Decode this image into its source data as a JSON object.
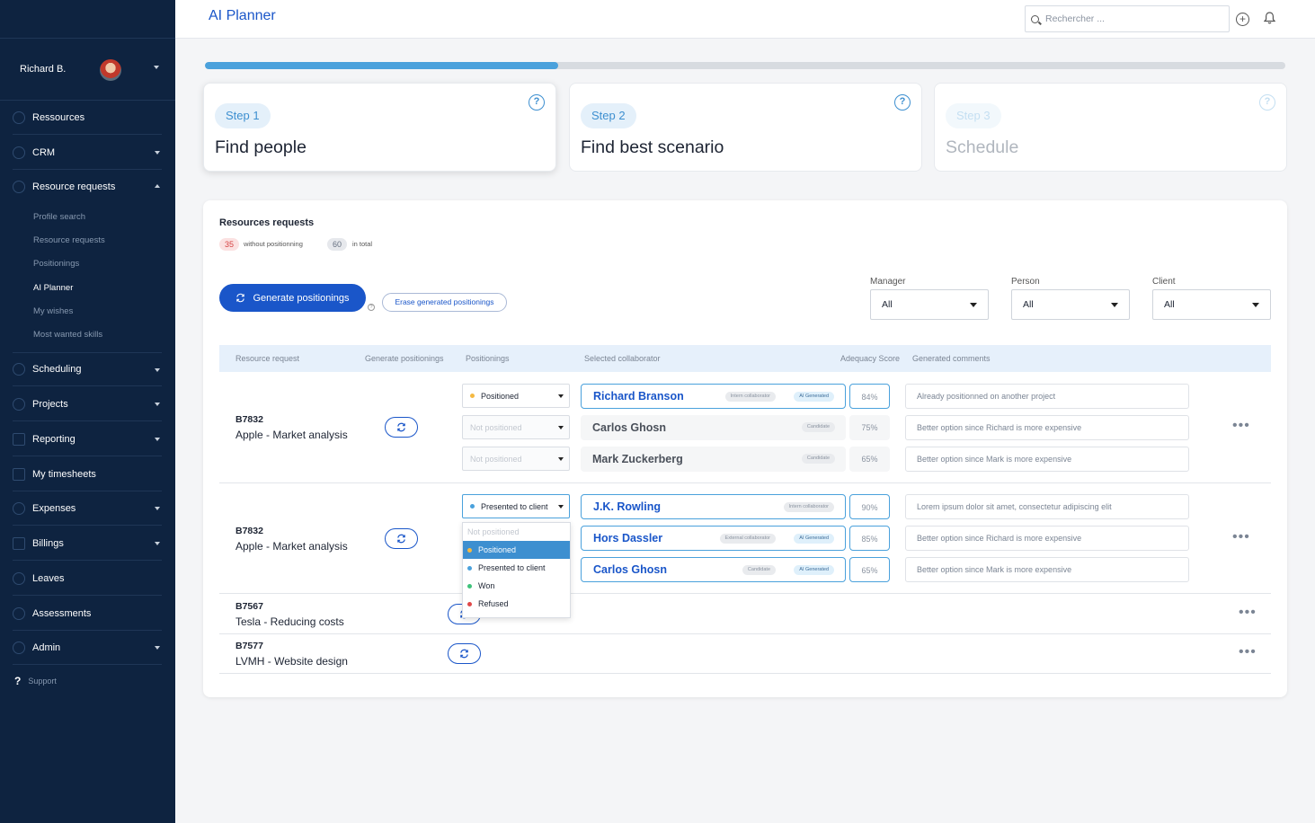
{
  "app": {
    "title": "AI Planner"
  },
  "search": {
    "placeholder": "Rechercher ..."
  },
  "user": {
    "name": "Richard B."
  },
  "sidebar": {
    "items": [
      {
        "label": "Ressources"
      },
      {
        "label": "CRM"
      },
      {
        "label": "Resource requests"
      },
      {
        "label": "Scheduling"
      },
      {
        "label": "Projects"
      },
      {
        "label": "Reporting"
      },
      {
        "label": "My timesheets"
      },
      {
        "label": "Expenses"
      },
      {
        "label": "Billings"
      },
      {
        "label": "Leaves"
      },
      {
        "label": "Assessments"
      },
      {
        "label": "Admin"
      }
    ],
    "sub_items": [
      {
        "label": "Profile search"
      },
      {
        "label": "Resource requests"
      },
      {
        "label": "Positionings"
      },
      {
        "label": "AI Planner"
      },
      {
        "label": "My wishes"
      },
      {
        "label": "Most wanted skills"
      }
    ],
    "support": "Support"
  },
  "progress": {
    "fraction": 0.327
  },
  "steps": [
    {
      "pill": "Step 1",
      "name": "Find people"
    },
    {
      "pill": "Step 2",
      "name": "Find best scenario"
    },
    {
      "pill": "Step 3",
      "name": "Schedule"
    }
  ],
  "panel": {
    "title": "Resources requests",
    "count_without": "35",
    "label_without": "without positionning",
    "count_total": "60",
    "label_total": "in total",
    "generate_label": "Generate positionings",
    "erase_label": "Erase generated positionings"
  },
  "filters": [
    {
      "label": "Manager",
      "value": "All"
    },
    {
      "label": "Person",
      "value": "All"
    },
    {
      "label": "Client",
      "value": "All"
    }
  ],
  "table": {
    "headers": [
      "Resource request",
      "Generate positionings",
      "Positionings",
      "Selected collaborator",
      "Adequacy Score",
      "Generated comments"
    ],
    "rows": [
      {
        "id": "B7832",
        "name": "Apple - Market analysis",
        "lines": [
          {
            "status": "Positioned",
            "collaborator": "Richard Branson",
            "tag": "Intern collaborator",
            "ai": "AI Generated",
            "score": "84%",
            "comment": "Already positionned on another project"
          },
          {
            "status": "Not positioned",
            "collaborator": "Carlos Ghosn",
            "tag": "Candidate",
            "ai": "",
            "score": "75%",
            "comment": "Better option since Richard is more expensive"
          },
          {
            "status": "Not positioned",
            "collaborator": "Mark Zuckerberg",
            "tag": "Candidate",
            "ai": "",
            "score": "65%",
            "comment": "Better option since Mark is more expensive"
          }
        ]
      },
      {
        "id": "B7832",
        "name": "Apple - Market analysis",
        "lines": [
          {
            "status": "Presented to client",
            "collaborator": "J.K. Rowling",
            "tag": "Intern collaborator",
            "ai": "",
            "score": "90%",
            "comment": "Lorem ipsum dolor sit amet, consectetur adipiscing elit"
          },
          {
            "status": "",
            "collaborator": "Hors Dassler",
            "tag": "External collaborator",
            "ai": "AI Generated",
            "score": "85%",
            "comment": "Better option since Richard is more expensive"
          },
          {
            "status": "",
            "collaborator": "Carlos Ghosn",
            "tag": "Candidate",
            "ai": "AI Generated",
            "score": "65%",
            "comment": "Better option since Mark is more expensive"
          }
        ]
      },
      {
        "id": "B7567",
        "name": "Tesla - Reducing costs"
      },
      {
        "id": "B7577",
        "name": "LVMH - Website design"
      }
    ]
  },
  "dropdown": {
    "options": [
      "Not positioned",
      "Positioned",
      "Presented to client",
      "Won",
      "Refused"
    ]
  },
  "colors": {
    "primary": "#1a56c9",
    "accent": "#4aa1dc",
    "sidebar_bg": "#0e2340",
    "positioned": "#f5b942",
    "presented": "#4aa1dc",
    "won": "#3ec27a",
    "refused": "#e04848"
  }
}
